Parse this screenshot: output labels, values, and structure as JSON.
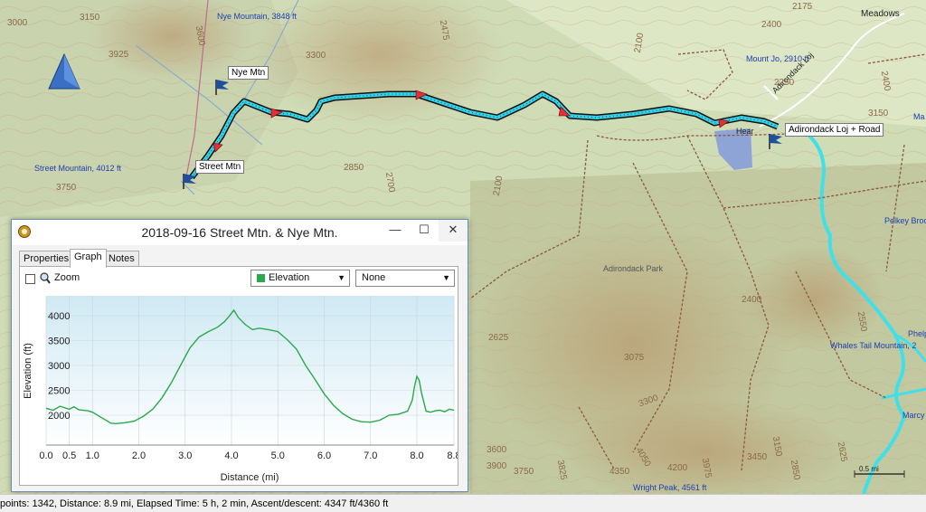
{
  "map": {
    "peaks": [
      {
        "name": "Nye Mountain, 3848 ft"
      },
      {
        "name": "Mount Jo, 2910 ft"
      },
      {
        "name": "Street Mountain, 4012 ft"
      },
      {
        "name": "Whales Tail Mountain, 2"
      },
      {
        "name": "Wright Peak, 4561 ft"
      }
    ],
    "waypoints": {
      "nye": "Nye Mtn",
      "street": "Street Mtn",
      "loj": "Adirondack Loj + Road"
    },
    "place_labels": {
      "meadows": "Meadows",
      "adirondack_park": "Adirondack Park",
      "heart": "Hear",
      "pelkey": "Pelkey Broo",
      "phelps": "Phelp",
      "marcy": "Marcy D",
      "ma": "Ma",
      "adirondack_loj_road": "Adirondack Loj"
    },
    "contours": [
      "3150",
      "3000",
      "3925",
      "3600",
      "3750",
      "3300",
      "2475",
      "2400",
      "2175",
      "2100",
      "2250",
      "2850",
      "2700",
      "2100",
      "2625",
      "3075",
      "2400",
      "3300",
      "3600",
      "3900",
      "3750",
      "3825",
      "4350",
      "4050",
      "4200",
      "3975",
      "3450",
      "3150",
      "2850",
      "2400",
      "2550",
      "3150",
      "2625"
    ],
    "scale_label": "0.5 mi",
    "colors": {
      "track": "#35d1e6",
      "water": "#3fe0e8",
      "lake": "#8ea3d6"
    }
  },
  "window": {
    "title": "2018-09-16 Street Mtn. & Nye Mtn.",
    "tabs": [
      "Properties",
      "Graph",
      "Notes"
    ],
    "active_tab": "Graph",
    "zoom_label": "Zoom",
    "dropdown_primary": "Elevation",
    "dropdown_secondary": "None",
    "minimize": "—",
    "maximize": "☐",
    "close": "✕"
  },
  "chart_data": {
    "type": "line",
    "title": "",
    "xlabel": "Distance  (mi)",
    "ylabel": "Elevation (ft)",
    "xlim": [
      0,
      8.8
    ],
    "ylim": [
      1400,
      4400
    ],
    "x_ticks": [
      "0.0",
      "0.5",
      "1.0",
      "2.0",
      "3.0",
      "4.0",
      "5.0",
      "6.0",
      "7.0",
      "8.0",
      "8.8"
    ],
    "x_tick_values": [
      0,
      0.5,
      1,
      2,
      3,
      4,
      5,
      6,
      7,
      8,
      8.8
    ],
    "y_ticks": [
      "2000",
      "2500",
      "3000",
      "3500",
      "4000"
    ],
    "y_tick_values": [
      2000,
      2500,
      3000,
      3500,
      4000
    ],
    "series": [
      {
        "color": "#2ba84a",
        "x": [
          0,
          0.15,
          0.3,
          0.5,
          0.6,
          0.7,
          0.9,
          1.0,
          1.2,
          1.4,
          1.5,
          1.7,
          1.9,
          2.1,
          2.3,
          2.5,
          2.7,
          2.9,
          3.1,
          3.3,
          3.5,
          3.7,
          3.85,
          3.95,
          4.05,
          4.15,
          4.3,
          4.45,
          4.6,
          4.8,
          5.0,
          5.2,
          5.4,
          5.6,
          5.8,
          6.0,
          6.2,
          6.4,
          6.6,
          6.8,
          7.0,
          7.2,
          7.4,
          7.6,
          7.8,
          7.9,
          7.95,
          8.0,
          8.05,
          8.1,
          8.2,
          8.3,
          8.4,
          8.5,
          8.6,
          8.7,
          8.8
        ],
        "y": [
          2140,
          2100,
          2180,
          2120,
          2170,
          2110,
          2090,
          2060,
          1950,
          1840,
          1830,
          1850,
          1880,
          1980,
          2120,
          2350,
          2650,
          3000,
          3350,
          3570,
          3680,
          3770,
          3880,
          3990,
          4110,
          3960,
          3820,
          3720,
          3750,
          3720,
          3680,
          3520,
          3330,
          3000,
          2720,
          2430,
          2200,
          2030,
          1920,
          1870,
          1860,
          1900,
          2000,
          2020,
          2080,
          2300,
          2580,
          2780,
          2700,
          2450,
          2080,
          2060,
          2090,
          2100,
          2070,
          2120,
          2100
        ]
      }
    ]
  },
  "status": {
    "text": "points: 1342, Distance: 8.9 mi, Elapsed Time: 5 h, 2 min, Ascent/descent: 4347 ft/4360 ft"
  }
}
